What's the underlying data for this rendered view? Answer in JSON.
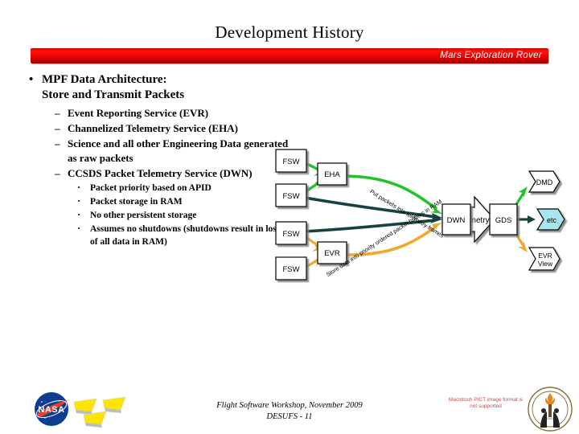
{
  "slide": {
    "title": "Development History",
    "banner_label": "Mars Exploration Rover",
    "banner_color": "#e00000"
  },
  "bullets": {
    "level1": {
      "marker": "•",
      "line1": "MPF Data Architecture:",
      "line2": "Store and Transmit Packets"
    },
    "level2_marker": "–",
    "level2": [
      "Event Reporting Service (EVR)",
      "Channelized Telemetry Service (EHA)",
      "Science and all other Engineering Data generated as raw packets",
      "CCSDS Packet Telemetry Service (DWN)"
    ],
    "level3_marker": "·",
    "level3": [
      "Packet priority based on APID",
      "Packet storage in RAM",
      "No other persistent storage",
      "Assumes no shutdowns (shutdowns result in loss of all data in RAM)"
    ]
  },
  "diagram": {
    "nodes": {
      "fsw1": "FSW",
      "fsw2": "FSW",
      "fsw3": "FSW",
      "fsw4": "FSW",
      "eha": "EHA",
      "evr": "EVR",
      "dwn": "DWN",
      "gds": "GDS",
      "dmd": "DMD",
      "etc": "etc",
      "evrview_line1": "EVR",
      "evrview_line2": "View"
    },
    "arrow_label": "Telemetry",
    "annotations": {
      "top": "Store data into priority ordered packet buffers in RAM",
      "bottom": "Put packets into telemetry frames"
    },
    "colors": {
      "green": "#22c32a",
      "dark_teal": "#17423f",
      "orange": "#f0a830",
      "etc_fill": "#a8e6ef",
      "box_fill": "#ffffff",
      "box_stroke": "#000000"
    }
  },
  "footer": {
    "line1": "Flight Software Workshop, November 2009",
    "line2": "DESUFS - 11",
    "pict_note": "Macintosh PICT image format is not supported",
    "nasa_label": "NASA"
  }
}
